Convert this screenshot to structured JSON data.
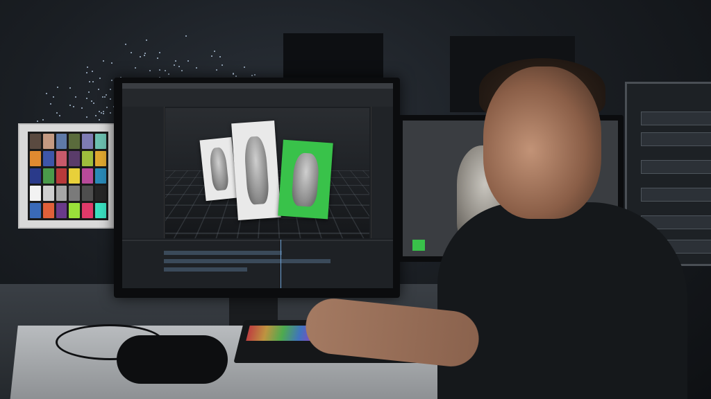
{
  "scene": {
    "description_colors": {
      "background": "#14171b",
      "accent_green": "#39c24a",
      "skin": "#a47a62"
    }
  },
  "color_chart": {
    "swatches": [
      "#5a4a40",
      "#c49a82",
      "#5f7aa8",
      "#5a6b3c",
      "#7f7cb4",
      "#6cc0b0",
      "#e08a30",
      "#3e56a8",
      "#c85a6a",
      "#5a3c6a",
      "#9ebe3c",
      "#e0a830",
      "#2a3a8a",
      "#4a9a4a",
      "#b83a3a",
      "#e8d03a",
      "#b84a9a",
      "#2a8ab8",
      "#f2f2f2",
      "#cfcfcf",
      "#a6a6a6",
      "#7a7a7a",
      "#4e4e4e",
      "#262626",
      "#3a6ab8",
      "#e0603a",
      "#6a3a8a",
      "#9ae03a",
      "#e03a6a",
      "#3ae0c0"
    ]
  }
}
